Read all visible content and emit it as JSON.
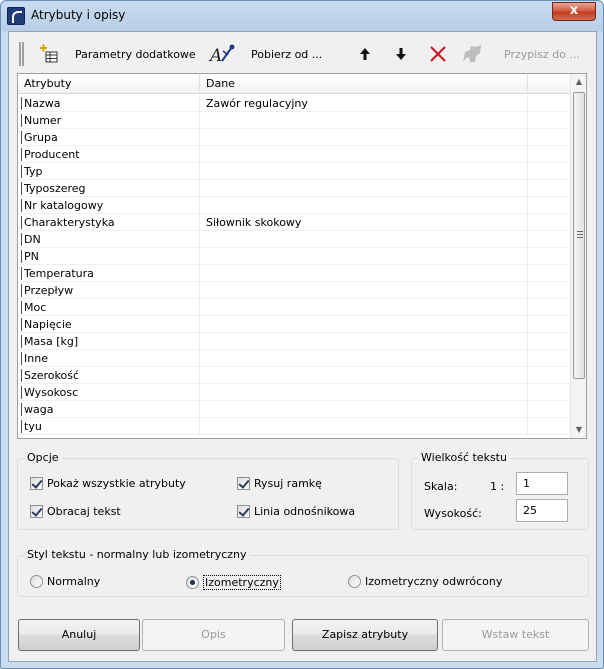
{
  "window": {
    "title": "Atrybuty i opisy",
    "close_glyph": "x"
  },
  "toolbar": {
    "add_params_label": "Parametry dodatkowe",
    "fetch_label": "Pobierz od ...",
    "assign_label": "Przypisz do ..."
  },
  "grid": {
    "columns": [
      "Atrybuty",
      "Dane"
    ],
    "rows": [
      {
        "attr": "Nazwa",
        "value": "Zawór regulacyjny"
      },
      {
        "attr": "Numer",
        "value": ""
      },
      {
        "attr": "Grupa",
        "value": ""
      },
      {
        "attr": "Producent",
        "value": ""
      },
      {
        "attr": "Typ",
        "value": ""
      },
      {
        "attr": "Typoszereg",
        "value": ""
      },
      {
        "attr": "Nr katalogowy",
        "value": ""
      },
      {
        "attr": "Charakterystyka",
        "value": "Siłownik skokowy"
      },
      {
        "attr": "DN",
        "value": ""
      },
      {
        "attr": "PN",
        "value": ""
      },
      {
        "attr": "Temperatura",
        "value": ""
      },
      {
        "attr": "Przepływ",
        "value": ""
      },
      {
        "attr": "Moc",
        "value": ""
      },
      {
        "attr": "Napięcie",
        "value": ""
      },
      {
        "attr": "Masa [kg]",
        "value": ""
      },
      {
        "attr": "Inne",
        "value": ""
      },
      {
        "attr": "Szerokość",
        "value": ""
      },
      {
        "attr": "Wysokosc",
        "value": ""
      },
      {
        "attr": "waga",
        "value": ""
      },
      {
        "attr": "tyu",
        "value": ""
      }
    ]
  },
  "options": {
    "legend": "Opcje",
    "show_all": {
      "label": "Pokaż wszystkie atrybuty",
      "checked": true
    },
    "rotate_text": {
      "label": "Obracaj tekst",
      "checked": true
    },
    "draw_frame": {
      "label": "Rysuj ramkę",
      "checked": true
    },
    "leader_line": {
      "label": "Linia odnośnikowa",
      "checked": true
    }
  },
  "text_size": {
    "legend": "Wielkość tekstu",
    "scale_label": "Skala:",
    "scale_prefix": "1 :",
    "scale_value": "1",
    "height_label": "Wysokość:",
    "height_value": "25"
  },
  "text_style": {
    "legend": "Styl tekstu - normalny lub izometryczny",
    "normal": "Normalny",
    "isometric": "Izometryczny",
    "isometric_reversed": "Izometryczny odwrócony",
    "selected": "isometric"
  },
  "buttons": {
    "cancel": "Anuluj",
    "description": "Opis",
    "save": "Zapisz atrybuty",
    "insert_text": "Wstaw tekst"
  }
}
